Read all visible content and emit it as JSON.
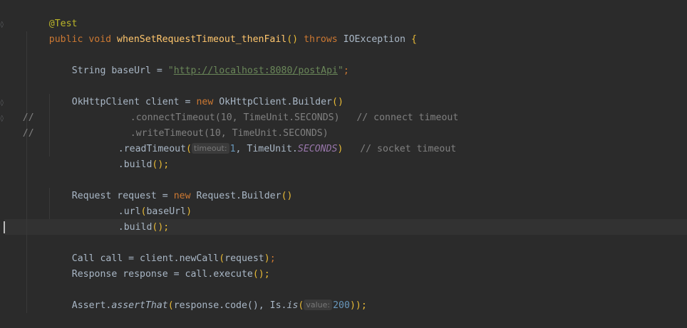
{
  "code": {
    "annotation": "@Test",
    "method_modifiers": "public void ",
    "method_name": "whenSetRequestTimeout_thenFail",
    "method_parens": "()",
    "throws_kw": " throws ",
    "exception_type": "IOException",
    "open_brace": " {",
    "line_baseurl_decl": "String baseUrl = ",
    "line_baseurl_url": "http://localhost:8080/postApi",
    "line_client_decl": "OkHttpClient client = ",
    "new_kw": "new",
    "client_builder": " OkHttpClient.Builder",
    "empty_parens": "()",
    "commented_connect": ".connectTimeout(10, TimeUnit.SECONDS)   // connect timeout",
    "commented_write": ".writeTimeout(10, TimeUnit.SECONDS)",
    "comment_slashes": "//",
    "read_timeout_call": ".readTimeout",
    "open_paren": "(",
    "hint_timeout": "timeout:",
    "read_timeout_value": "1",
    "timeunit_prefix": ", TimeUnit.",
    "timeunit_seconds": "SECONDS",
    "close_paren": ")",
    "socket_comment": "   // socket timeout",
    "build_call": ".build",
    "semicolon_parens": "();",
    "line_request_decl": "Request request = ",
    "request_builder": " Request.Builder",
    "url_call": ".url",
    "url_arg": "baseUrl",
    "line_call_decl": "Call call = client.newCall",
    "call_arg": "request",
    "line_response_decl": "Response response = call.execute",
    "assert_prefix": "Assert.",
    "assert_method": "assertThat",
    "assert_args": "response.code(), Is.",
    "is_method": "is",
    "hint_value": "value:",
    "expected_value": "200",
    "close_parens_semicolon": "));",
    "close_brace": "}",
    "quote": "\"",
    "semicolon": ";"
  },
  "colors": {
    "background": "#2b2b2b",
    "keyword": "#cc7832",
    "annotation": "#bbb529",
    "function": "#ffc66d",
    "string": "#6a8759",
    "comment": "#808080",
    "number": "#6897bb",
    "constant": "#9876aa",
    "text": "#a9b7c6"
  }
}
